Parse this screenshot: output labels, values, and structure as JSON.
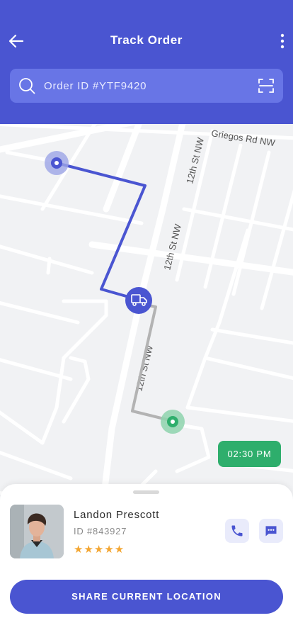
{
  "header": {
    "title": "Track Order",
    "back_icon": "arrow-left-icon",
    "more_icon": "more-vertical-icon",
    "background": "#4a55d1"
  },
  "search": {
    "placeholder": "Order ID #YTF9420",
    "value": "",
    "search_icon": "search-icon",
    "scan_icon": "scan-icon"
  },
  "map": {
    "street_labels": [
      "Griegos Rd NW",
      "12th St NW",
      "12th St NW",
      "12th St NW"
    ],
    "delivery_marker_icon": "truck-icon",
    "eta": "02:30 PM",
    "route_color": "#4a55d1",
    "remaining_route_color": "#b3b3b3",
    "destination_color": "#2eae6c"
  },
  "driver": {
    "name": "Landon Prescott",
    "id": "ID #843927",
    "rating": 5,
    "stars": "★★★★★",
    "call_icon": "phone-icon",
    "chat_icon": "chat-icon"
  },
  "actions": {
    "share_label": "SHARE CURRENT LOCATION"
  }
}
